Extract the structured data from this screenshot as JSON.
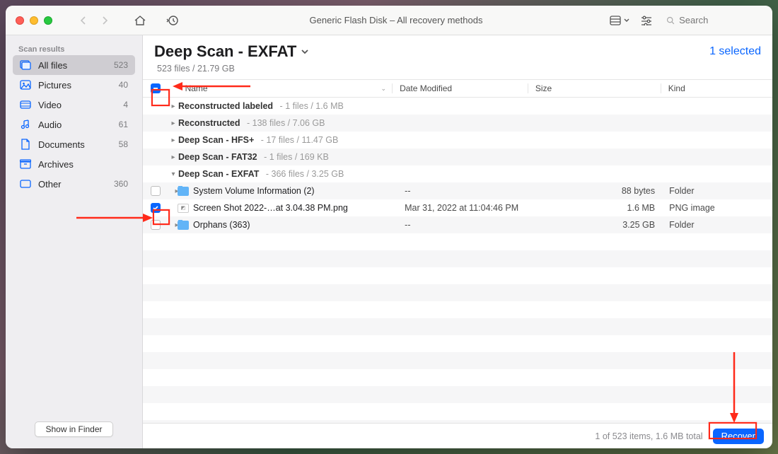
{
  "window_title": "Generic Flash Disk – All recovery methods",
  "search": {
    "placeholder": "Search"
  },
  "sidebar": {
    "header": "Scan results",
    "items": [
      {
        "label": "All files",
        "count": "523",
        "icon": "allfiles",
        "selected": true
      },
      {
        "label": "Pictures",
        "count": "40",
        "icon": "pictures",
        "selected": false
      },
      {
        "label": "Video",
        "count": "4",
        "icon": "video",
        "selected": false
      },
      {
        "label": "Audio",
        "count": "61",
        "icon": "audio",
        "selected": false
      },
      {
        "label": "Documents",
        "count": "58",
        "icon": "documents",
        "selected": false
      },
      {
        "label": "Archives",
        "count": "",
        "icon": "archives",
        "selected": false
      },
      {
        "label": "Other",
        "count": "360",
        "icon": "other",
        "selected": false
      }
    ],
    "show_in_finder": "Show in Finder"
  },
  "main": {
    "title": "Deep Scan - EXFAT",
    "subtitle": "523 files / 21.79 GB",
    "selected_text": "1 selected"
  },
  "columns": {
    "name": "Name",
    "date": "Date Modified",
    "size": "Size",
    "kind": "Kind"
  },
  "groups": [
    {
      "label": "Reconstructed labeled",
      "meta": "1 files / 1.6 MB",
      "expanded": false
    },
    {
      "label": "Reconstructed",
      "meta": "138 files / 7.06 GB",
      "expanded": false
    },
    {
      "label": "Deep Scan - HFS+",
      "meta": "17 files / 11.47 GB",
      "expanded": false
    },
    {
      "label": "Deep Scan - FAT32",
      "meta": "1 files / 169 KB",
      "expanded": false
    },
    {
      "label": "Deep Scan - EXFAT",
      "meta": "366 files / 3.25 GB",
      "expanded": true
    }
  ],
  "rows": [
    {
      "checked": false,
      "expandable": true,
      "icon": "folder",
      "name": "System Volume Information (2)",
      "date": "--",
      "size": "88 bytes",
      "kind": "Folder"
    },
    {
      "checked": true,
      "expandable": false,
      "icon": "image",
      "name": "Screen Shot 2022-…at 3.04.38 PM.png",
      "date": "Mar 31, 2022 at 11:04:46 PM",
      "size": "1.6 MB",
      "kind": "PNG image"
    },
    {
      "checked": false,
      "expandable": true,
      "icon": "folder",
      "name": "Orphans (363)",
      "date": "--",
      "size": "3.25 GB",
      "kind": "Folder"
    }
  ],
  "footer": {
    "status": "1 of 523 items, 1.6 MB total",
    "recover": "Recover"
  },
  "annotation_colors": {
    "stroke": "#ff2a1a"
  }
}
